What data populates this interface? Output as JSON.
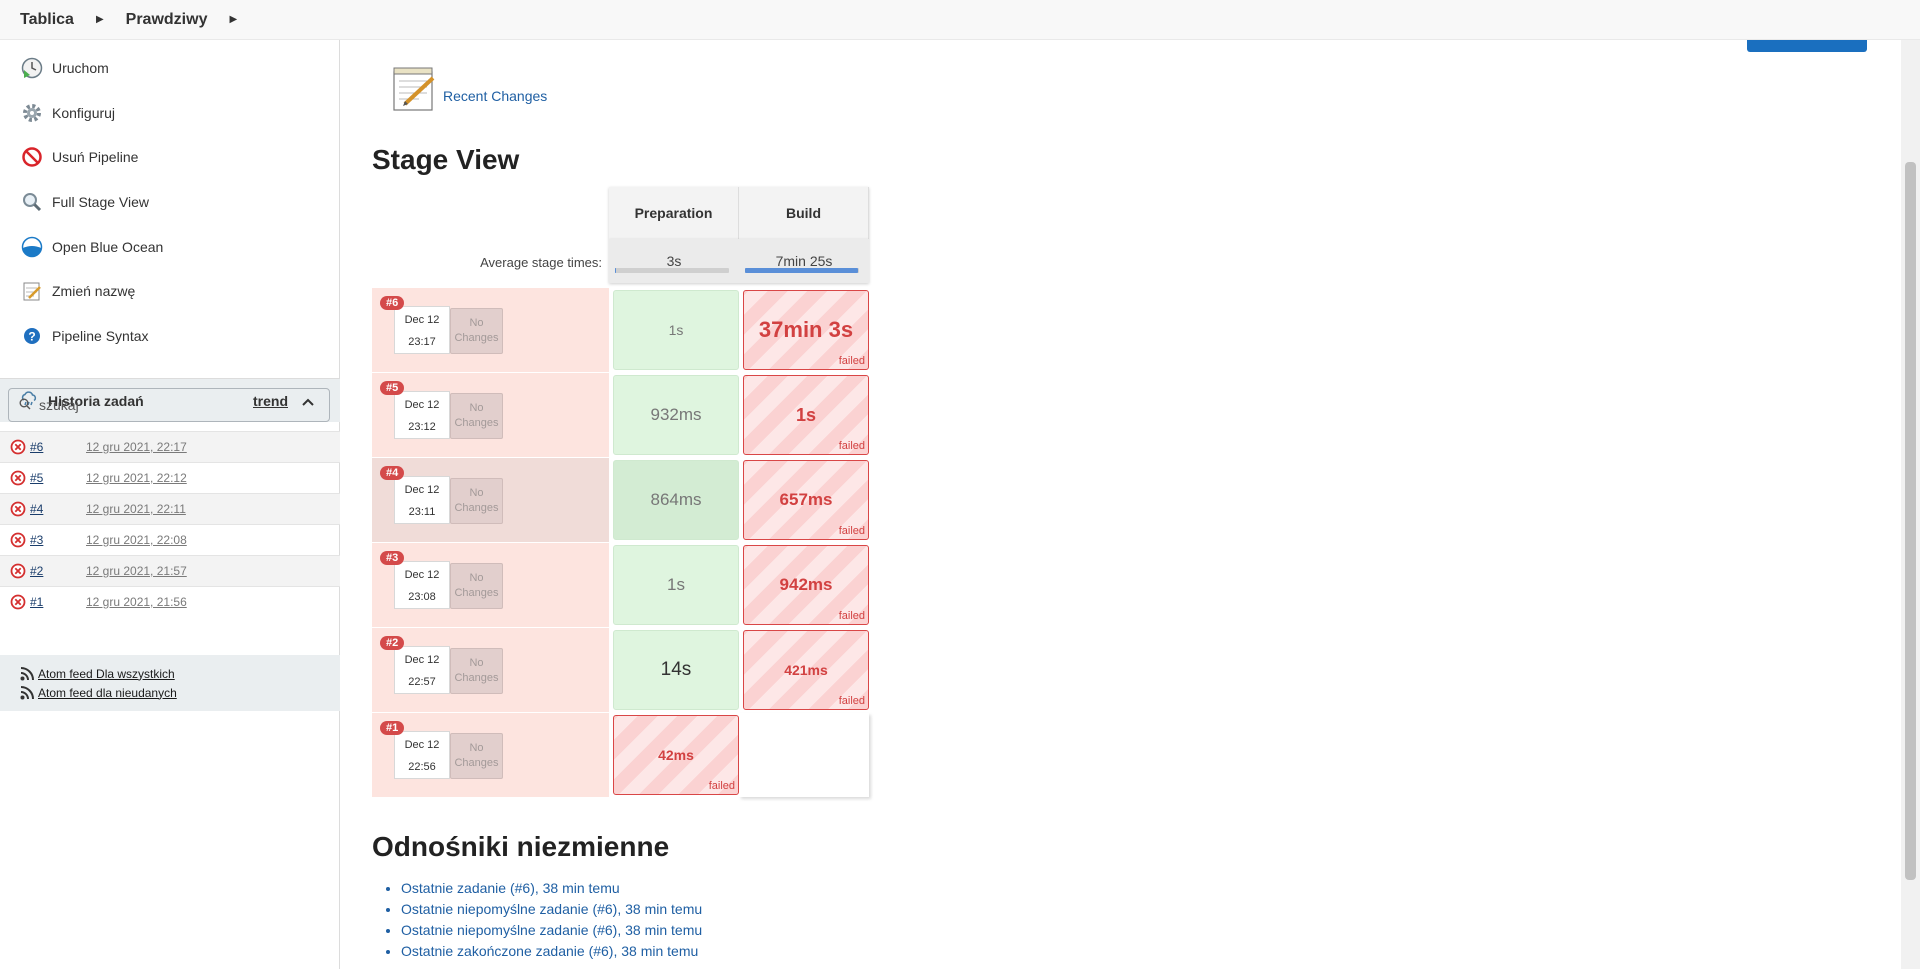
{
  "breadcrumb": {
    "items": [
      "Tablica",
      "Prawdziwy"
    ]
  },
  "sidebar": {
    "tasks": [
      {
        "label": "Uruchom",
        "icon": "run-clock-icon"
      },
      {
        "label": "Konfiguruj",
        "icon": "gear-icon"
      },
      {
        "label": "Usuń Pipeline",
        "icon": "no-entry-icon"
      },
      {
        "label": "Full Stage View",
        "icon": "magnifier-icon"
      },
      {
        "label": "Open Blue Ocean",
        "icon": "blue-ocean-icon"
      },
      {
        "label": "Zmień nazwę",
        "icon": "notepad-icon"
      },
      {
        "label": "Pipeline Syntax",
        "icon": "help-icon"
      }
    ],
    "history": {
      "title": "Historia zadań",
      "trend": "trend",
      "search_placeholder": "szukaj",
      "builds": [
        {
          "num": "#6",
          "date": "12 gru 2021, 22:17",
          "status": "failed"
        },
        {
          "num": "#5",
          "date": "12 gru 2021, 22:12",
          "status": "failed"
        },
        {
          "num": "#4",
          "date": "12 gru 2021, 22:11",
          "status": "failed"
        },
        {
          "num": "#3",
          "date": "12 gru 2021, 22:08",
          "status": "failed"
        },
        {
          "num": "#2",
          "date": "12 gru 2021, 21:57",
          "status": "failed"
        },
        {
          "num": "#1",
          "date": "12 gru 2021, 21:56",
          "status": "failed"
        }
      ],
      "feeds": [
        "Atom feed Dla wszystkich",
        "Atom feed dla nieudanych"
      ]
    }
  },
  "main": {
    "recent_changes": "Recent Changes",
    "stage_view": {
      "title": "Stage View",
      "stages": [
        "Preparation",
        "Build"
      ],
      "average_label": "Average stage times:",
      "averages": [
        "3s",
        "7min 25s"
      ],
      "average_bar_fraction": [
        0.01,
        0.99
      ],
      "runs": [
        {
          "badge": "#6",
          "date": "Dec 12",
          "time": "23:17",
          "changes": "No Changes",
          "stages": [
            {
              "value": "1s",
              "status": "success"
            },
            {
              "value": "37min 3s",
              "status": "failed"
            }
          ]
        },
        {
          "badge": "#5",
          "date": "Dec 12",
          "time": "23:12",
          "changes": "No Changes",
          "stages": [
            {
              "value": "932ms",
              "status": "success"
            },
            {
              "value": "1s",
              "status": "failed"
            }
          ]
        },
        {
          "badge": "#4",
          "date": "Dec 12",
          "time": "23:11",
          "changes": "No Changes",
          "stages": [
            {
              "value": "864ms",
              "status": "success"
            },
            {
              "value": "657ms",
              "status": "failed"
            }
          ]
        },
        {
          "badge": "#3",
          "date": "Dec 12",
          "time": "23:08",
          "changes": "No Changes",
          "stages": [
            {
              "value": "1s",
              "status": "success"
            },
            {
              "value": "942ms",
              "status": "failed"
            }
          ]
        },
        {
          "badge": "#2",
          "date": "Dec 12",
          "time": "22:57",
          "changes": "No Changes",
          "stages": [
            {
              "value": "14s",
              "status": "success"
            },
            {
              "value": "421ms",
              "status": "failed"
            }
          ]
        },
        {
          "badge": "#1",
          "date": "Dec 12",
          "time": "22:56",
          "changes": "No Changes",
          "stages": [
            {
              "value": "42ms",
              "status": "failed"
            }
          ]
        }
      ],
      "failed_label": "failed"
    },
    "permalinks": {
      "title": "Odnośniki niezmienne",
      "items": [
        "Ostatnie zadanie (#6), 38 min temu",
        "Ostatnie niepomyślne zadanie (#6), 38 min temu",
        "Ostatnie niepomyślne zadanie (#6), 38 min temu",
        "Ostatnie zakończone zadanie (#6), 38 min temu"
      ]
    }
  },
  "colors": {
    "link": "#1f5fa3",
    "failed": "#d24141",
    "success_bg": "#dff5df",
    "run_bg": "#fde4df",
    "accent_button": "#1a6fbf"
  }
}
